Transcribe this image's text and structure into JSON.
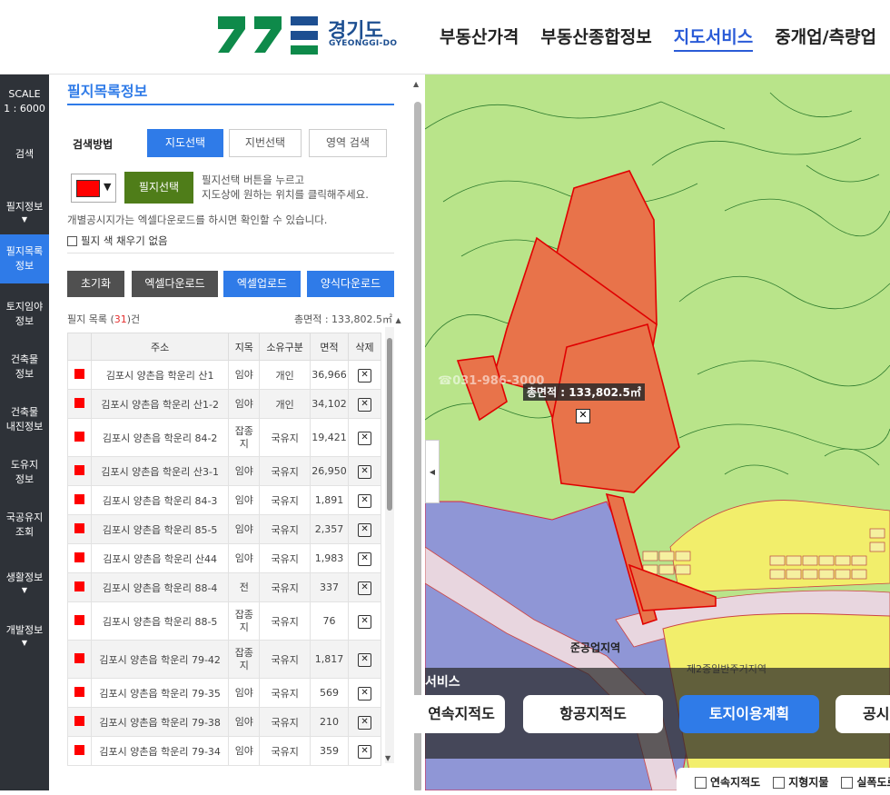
{
  "header": {
    "logo_text": "경기도",
    "logo_sub": "GYEONGGI-DO",
    "nav": [
      "부동산가격",
      "부동산종합정보",
      "지도서비스",
      "중개업/측량업"
    ],
    "active_nav": "지도서비스"
  },
  "sidebar": {
    "scale_label": "SCALE",
    "scale_value": "1 : 6000",
    "items": [
      "검색",
      "필지정보",
      "필지목록\n정보",
      "토지임야\n정보",
      "건축물\n정보",
      "건축물\n내진정보",
      "도유지\n정보",
      "국공유지\n조회",
      "생활정보",
      "개발정보"
    ]
  },
  "panel": {
    "title": "필지목록정보",
    "search_method_label": "검색방법",
    "segments": [
      "지도선택",
      "지번선택",
      "영역 검색"
    ],
    "parcel_button": "필지선택",
    "hint_line1": "필지선택 버튼을 누르고",
    "hint_line2": "지도상에 원하는 위치를 클릭해주세요.",
    "note": "개별공시지가는 엑셀다운로드를 하시면 확인할 수 있습니다.",
    "no_fill_label": "필지 색 채우기 없음",
    "actions": [
      "초기화",
      "엑셀다운로드",
      "엑셀업로드",
      "양식다운로드"
    ],
    "list_label": "필지 목록 (",
    "list_count": "31",
    "list_suffix": ")건",
    "total_area": "총면적 : 133,802.5㎡",
    "columns": [
      "주소",
      "지목",
      "소유구분",
      "면적",
      "삭제"
    ],
    "rows": [
      {
        "addr": "김포시 양촌읍 학운리 산1",
        "jimok": "임야",
        "owner": "개인",
        "area": "36,966"
      },
      {
        "addr": "김포시 양촌읍 학운리 산1-2",
        "jimok": "임야",
        "owner": "개인",
        "area": "34,102"
      },
      {
        "addr": "김포시 양촌읍 학운리 84-2",
        "jimok": "잡종\n지",
        "owner": "국유지",
        "area": "19,421"
      },
      {
        "addr": "김포시 양촌읍 학운리 산3-1",
        "jimok": "임야",
        "owner": "국유지",
        "area": "26,950"
      },
      {
        "addr": "김포시 양촌읍 학운리 84-3",
        "jimok": "임야",
        "owner": "국유지",
        "area": "1,891"
      },
      {
        "addr": "김포시 양촌읍 학운리 85-5",
        "jimok": "임야",
        "owner": "국유지",
        "area": "2,357"
      },
      {
        "addr": "김포시 양촌읍 학운리 산44",
        "jimok": "임야",
        "owner": "국유지",
        "area": "1,983"
      },
      {
        "addr": "김포시 양촌읍 학운리 88-4",
        "jimok": "전",
        "owner": "국유지",
        "area": "337"
      },
      {
        "addr": "김포시 양촌읍 학운리 88-5",
        "jimok": "잡종\n지",
        "owner": "국유지",
        "area": "76"
      },
      {
        "addr": "김포시 양촌읍 학운리 79-42",
        "jimok": "잡종\n지",
        "owner": "국유지",
        "area": "1,817"
      },
      {
        "addr": "김포시 양촌읍 학운리 79-35",
        "jimok": "임야",
        "owner": "국유지",
        "area": "569"
      },
      {
        "addr": "김포시 양촌읍 학운리 79-38",
        "jimok": "임야",
        "owner": "국유지",
        "area": "210"
      },
      {
        "addr": "김포시 양촌읍 학운리 79-34",
        "jimok": "임야",
        "owner": "국유지",
        "area": "359"
      }
    ]
  },
  "map": {
    "total_label": "총면적 : 133,802.5㎡",
    "watermark": "☎031-986-3000",
    "zone_label_1": "준공업지역",
    "zone_label_2": "제2종일반주거지역",
    "service_title": "서비스",
    "buttons": [
      "연속지적도",
      "항공지적도",
      "토지이용계획",
      "공시지가"
    ],
    "active_button": "토지이용계획",
    "legend": [
      "연속지적도",
      "지형지물",
      "실폭도로"
    ]
  },
  "colors": {
    "accent": "#2f7be8",
    "parcel_button": "#4f7d19",
    "selected_parcel": "#e8734a",
    "forest": "#b9e48a",
    "industrial": "#8f96d6",
    "residential": "#f2ee6b",
    "sidebar": "#2e3238"
  }
}
